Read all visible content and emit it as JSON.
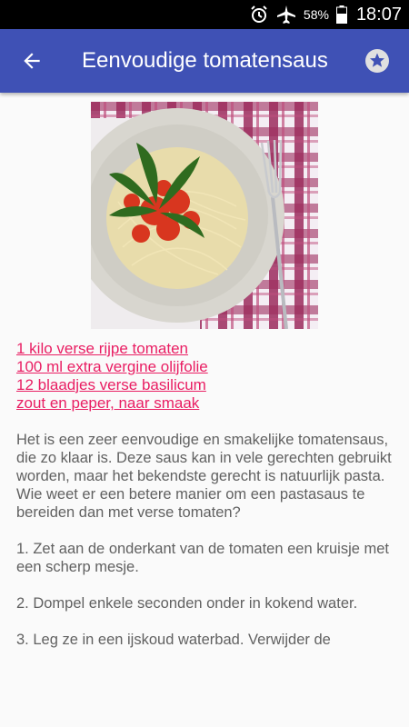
{
  "status_bar": {
    "battery_percent": "58%",
    "time": "18:07",
    "icons": [
      "alarm-icon",
      "airplane-mode-icon",
      "battery-icon"
    ]
  },
  "app_bar": {
    "title": "Eenvoudige tomatensaus",
    "back_icon": "arrow-back-icon",
    "favorite_icon": "star-icon",
    "color": "#3f51b5"
  },
  "recipe": {
    "image": "spaghetti-with-tomato-sauce-and-basil",
    "ingredients": [
      "1 kilo verse rijpe tomaten",
      "100 ml extra vergine olijfolie",
      "12 blaadjes verse basilicum",
      "zout en peper, naar smaak"
    ],
    "intro": "Het is een zeer eenvoudige en smakelijke tomatensaus, die zo klaar is. Deze saus kan in vele gerechten gebruikt worden, maar het bekendste gerecht is natuurlijk pasta. Wie weet er een betere manier om een pastasaus te bereiden dan met verse tomaten?",
    "steps": [
      "1. Zet aan de onderkant van de tomaten een kruisje met een scherp mesje.",
      "2. Dompel enkele seconden onder in kokend water.",
      "3. Leg ze in een ijskoud waterbad. Verwijder de"
    ],
    "link_color": "#e91e63"
  }
}
